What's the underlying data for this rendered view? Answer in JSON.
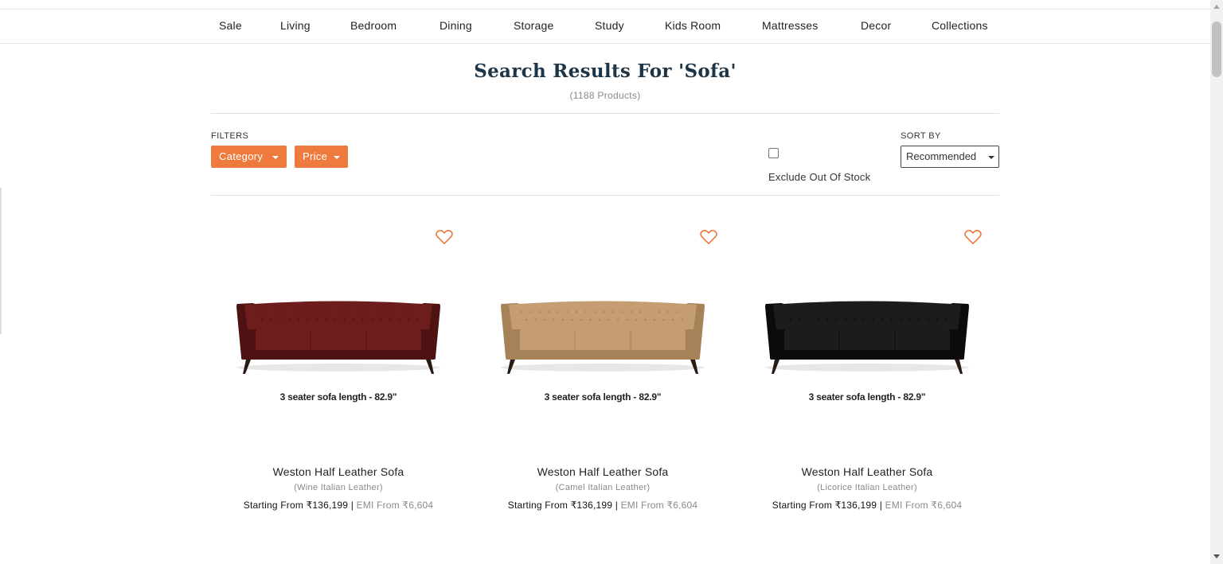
{
  "nav": {
    "items": [
      {
        "label": "Sale"
      },
      {
        "label": "Living"
      },
      {
        "label": "Bedroom"
      },
      {
        "label": "Dining"
      },
      {
        "label": "Storage"
      },
      {
        "label": "Study"
      },
      {
        "label": "Kids Room"
      },
      {
        "label": "Mattresses"
      },
      {
        "label": "Decor"
      },
      {
        "label": "Collections"
      }
    ]
  },
  "search": {
    "title": "Search Results For 'Sofa'",
    "count": "(1188 Products)"
  },
  "filters": {
    "label": "FILTERS",
    "category_label": "Category",
    "price_label": "Price",
    "exclude_label": "Exclude Out Of Stock",
    "exclude_checked": false,
    "sort_label": "SORT BY",
    "sort_value": "Recommended"
  },
  "products": [
    {
      "dimension_text": "3 seater sofa length - 82.9\"",
      "name": "Weston Half Leather Sofa",
      "variant": "(Wine Italian Leather)",
      "price_text": "Starting From ₹136,199",
      "separator": " | ",
      "emi_text": "EMI From ₹6,604",
      "color": "#6e1d1d",
      "color_dark": "#4e1212"
    },
    {
      "dimension_text": "3 seater sofa length - 82.9\"",
      "name": "Weston Half Leather Sofa",
      "variant": "(Camel Italian Leather)",
      "price_text": "Starting From ₹136,199",
      "separator": " | ",
      "emi_text": "EMI From ₹6,604",
      "color": "#c49e72",
      "color_dark": "#a78259"
    },
    {
      "dimension_text": "3 seater sofa length - 82.9\"",
      "name": "Weston Half Leather Sofa",
      "variant": "(Licorice Italian Leather)",
      "price_text": "Starting From ₹136,199",
      "separator": " | ",
      "emi_text": "EMI From ₹6,604",
      "color": "#1c1c1c",
      "color_dark": "#0b0b0b"
    }
  ],
  "colors": {
    "accent": "#ee7a3e",
    "title": "#1d3547",
    "muted": "#8a8a8a"
  }
}
